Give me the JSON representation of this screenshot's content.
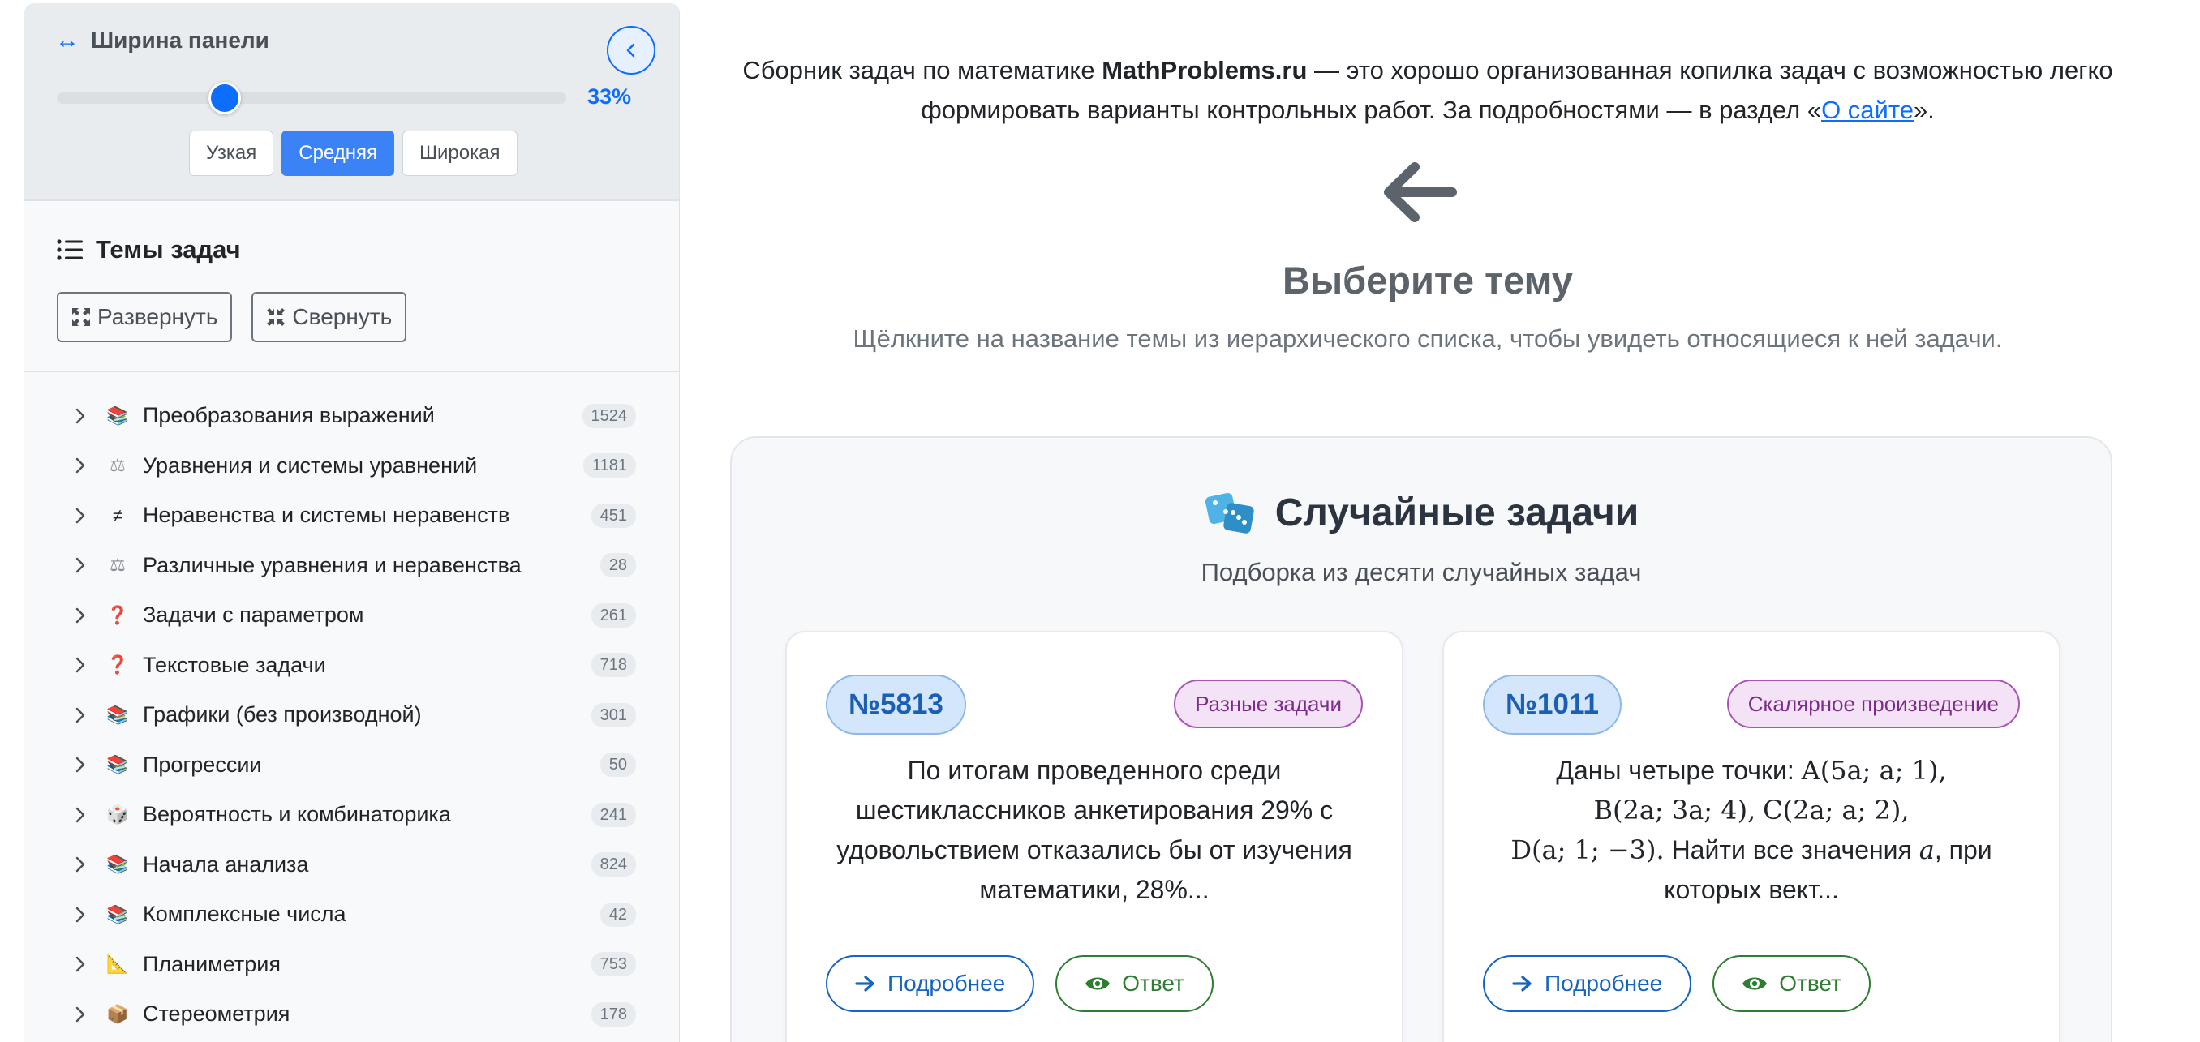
{
  "width_panel": {
    "title": "Ширина панели",
    "value_label": "33%",
    "value": 33,
    "buttons": [
      "Узкая",
      "Средняя",
      "Широкая"
    ],
    "active_button": "Средняя"
  },
  "topics": {
    "title": "Темы задач",
    "expand_label": "Развернуть",
    "collapse_label": "Свернуть",
    "items": [
      {
        "name": "Преобразования выражений",
        "count": "1524",
        "icon": "books-icon"
      },
      {
        "name": "Уравнения и системы уравнений",
        "count": "1181",
        "icon": "scales-icon"
      },
      {
        "name": "Неравенства и системы неравенств",
        "count": "451",
        "icon": "not-equal-icon"
      },
      {
        "name": "Различные уравнения и неравенства",
        "count": "28",
        "icon": "scales-icon"
      },
      {
        "name": "Задачи с параметром",
        "count": "261",
        "icon": "question-icon"
      },
      {
        "name": "Текстовые задачи",
        "count": "718",
        "icon": "question-icon"
      },
      {
        "name": "Графики (без производной)",
        "count": "301",
        "icon": "books-icon"
      },
      {
        "name": "Прогрессии",
        "count": "50",
        "icon": "books-icon"
      },
      {
        "name": "Вероятность и комбинаторика",
        "count": "241",
        "icon": "dice-icon"
      },
      {
        "name": "Начала анализа",
        "count": "824",
        "icon": "books-icon"
      },
      {
        "name": "Комплексные числа",
        "count": "42",
        "icon": "books-icon"
      },
      {
        "name": "Планиметрия",
        "count": "753",
        "icon": "triangle-ruler-icon"
      },
      {
        "name": "Стереометрия",
        "count": "178",
        "icon": "package-icon"
      }
    ]
  },
  "intro": {
    "text_before": "Сборник задач по математике ",
    "brand": "MathProblems.ru",
    "text_after": " — это хорошо организованная копилка задач с возможностью легко формировать варианты контрольных работ. За подробностями — в раздел «",
    "link": "О сайте",
    "text_end": "»."
  },
  "choose": {
    "title": "Выберите тему",
    "subtitle": "Щёлкните на название темы из иерархического списка, чтобы увидеть относящиеся к ней задачи."
  },
  "random": {
    "title": "Случайные задачи",
    "subtitle": "Подборка из десяти случайных задач",
    "cards": [
      {
        "number": "№5813",
        "category": "Разные задачи",
        "text": "По итогам проведенного среди шестиклассников анкетирования 29% с удовольствием отказались бы от изучения математики, 28%...",
        "more_label": "Подробнее",
        "answer_label": "Ответ"
      },
      {
        "number": "№1011",
        "category": "Скалярное произведение",
        "text_parts": {
          "p1": "Даны четыре точки: ",
          "mA": "A(5a; a; 1),",
          "mB": "B(2a; 3a; 4),",
          "mC": "C(2a; a; 2),",
          "mD": "D(a; 1; −3).",
          "p2": " Найти все значения ",
          "ma": "a",
          "p3": ", при которых вект..."
        },
        "more_label": "Подробнее",
        "answer_label": "Ответ"
      }
    ]
  },
  "colors": {
    "accent": "#0d6efd",
    "more_button": "#1565c0",
    "answer_button": "#2e7d32",
    "category_badge": "#7b2c8a"
  }
}
